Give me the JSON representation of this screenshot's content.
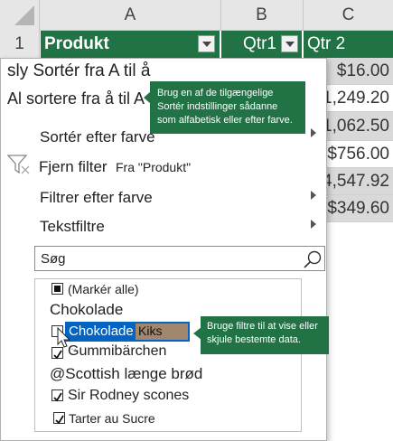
{
  "columns": [
    "A",
    "B",
    "C"
  ],
  "row_numbers": [
    "1"
  ],
  "header": {
    "produkt": "Produkt",
    "qtr1": "Qtr1",
    "qtr2": "Qtr 2"
  },
  "qtr2_values": [
    "$16.00",
    "$1,249.20",
    "$1,062.50",
    "$756.00",
    "$4,547.92",
    "$349.60"
  ],
  "menu": {
    "sort_asc": "sly Sortér fra A til å",
    "sort_desc": "Al sortere fra å til A",
    "sort_by_color": "Sortér efter farve",
    "clear_filter": "Fjern filter",
    "clear_filter_from": "Fra \"Produkt\"",
    "filter_by_color": "Filtrer efter farve",
    "text_filters": "Tekstfiltre",
    "search_placeholder": "Søg"
  },
  "list_items": {
    "select_all": "(Markér alle)",
    "chokolade_group": "Chokolade",
    "chokolade": "Chokolade",
    "kiks": "Kiks",
    "ghost": "...",
    "gummibarchen": "Gummibärchen",
    "scottish": "@Scottish længe brød",
    "sir_rodney": "Sir Rodney scones",
    "tarter": "Tarter au Sucre"
  },
  "tooltips": {
    "sort": "Brug en af de tilgængelige Sortér indstillinger sådanne som alfabetisk eller efter farve.",
    "filter": "Bruge filtre til at vise eller skjule bestemte data."
  },
  "colors": {
    "accent": "#217346",
    "band": "#d9d9d9",
    "highlight": "#0563c1",
    "kiks_bg": "#a0876e"
  },
  "icons": [
    "filter-clear-icon",
    "search-icon",
    "dropdown-arrow-icon",
    "submenu-arrow-icon",
    "checkbox-icon",
    "mouse-cursor-icon"
  ]
}
